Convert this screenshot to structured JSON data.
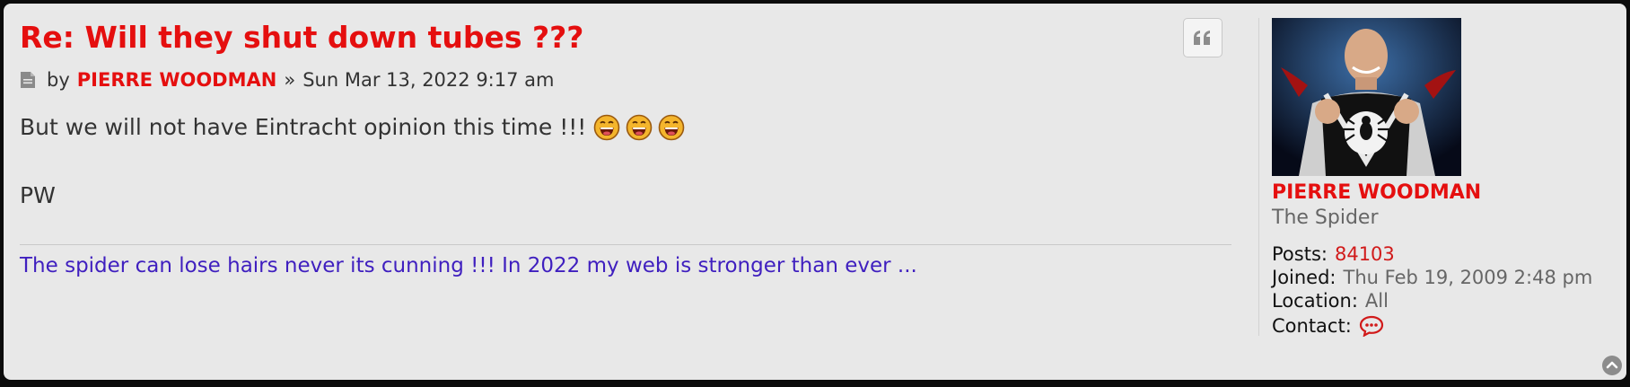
{
  "post": {
    "title": "Re: Will they shut down tubes ???",
    "by_label": "by",
    "author": "PIERRE WOODMAN",
    "separator": "»",
    "date": "Sun Mar 13, 2022 9:17 am",
    "body_line1": "But we will not have Eintracht opinion this time !!!",
    "body_line2": "PW",
    "emojis": [
      "laughing-emoji",
      "laughing-emoji",
      "laughing-emoji"
    ],
    "signature": "The spider can lose hairs never its cunning !!! In 2022 my web is stronger than ever ..."
  },
  "profile": {
    "name": "PIERRE WOODMAN",
    "rank": "The Spider",
    "posts_label": "Posts:",
    "posts_value": "84103",
    "joined_label": "Joined:",
    "joined_value": "Thu Feb 19, 2009 2:48 pm",
    "location_label": "Location:",
    "location_value": "All",
    "contact_label": "Contact:"
  },
  "icons": {
    "post": "post-icon",
    "quote": "quote-icon",
    "contact": "speech-bubble-icon",
    "back_to_top": "chevron-up-circle-icon"
  },
  "colors": {
    "accent_red": "#e50f0f",
    "signature_blue": "#3f1fbf",
    "panel_bg": "#e8e8e8",
    "page_bg": "#0b0b0b"
  }
}
